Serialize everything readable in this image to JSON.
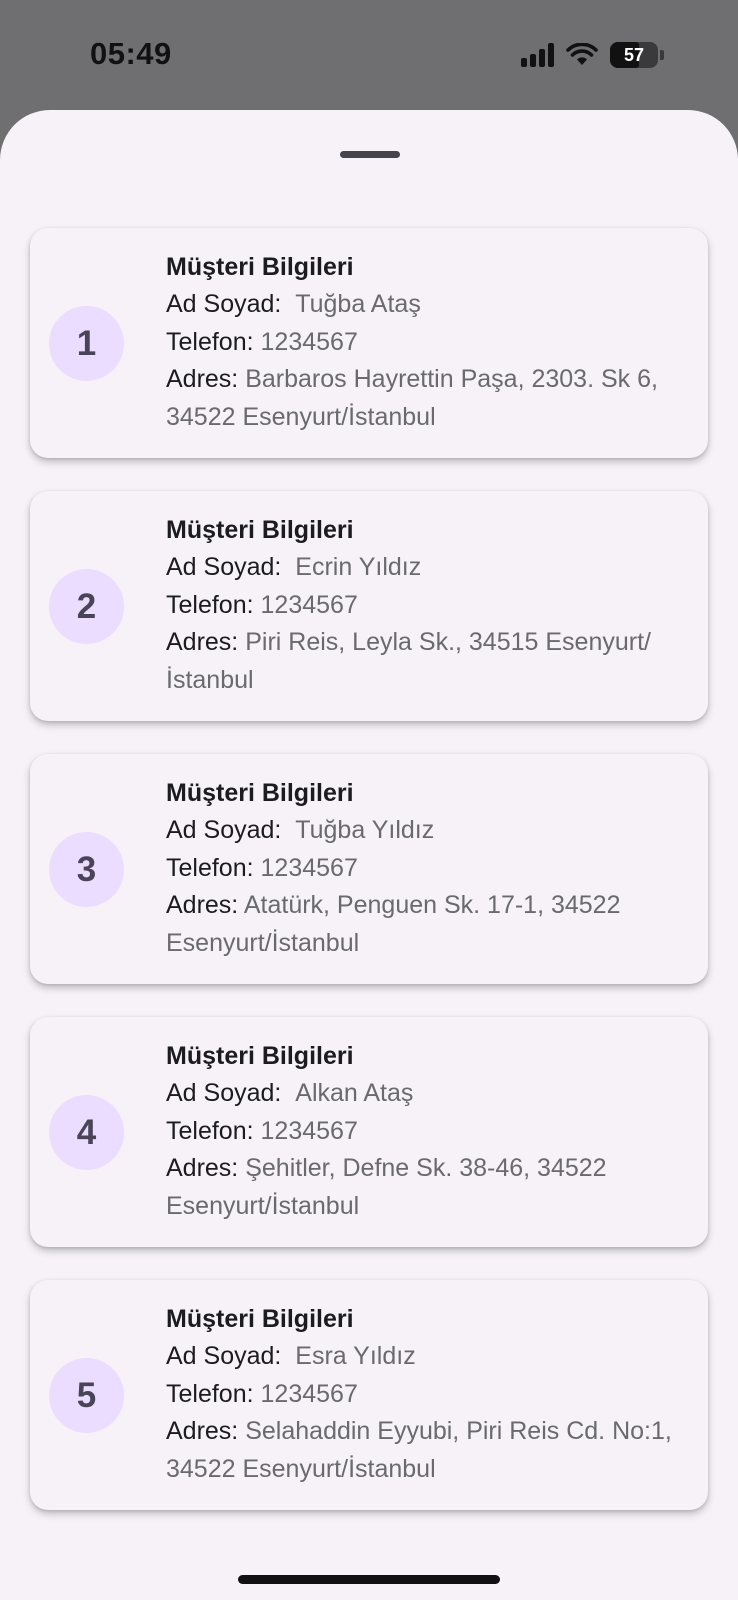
{
  "status_bar": {
    "time": "05:49",
    "battery_level": "57"
  },
  "customers": [
    {
      "number": "1",
      "title": "Müşteri Bilgileri",
      "name_label": "Ad Soyad:",
      "name": "Tuğba Ataş",
      "phone_label": "Telefon:",
      "phone": "1234567",
      "address_label": "Adres:",
      "address": "Barbaros Hayrettin Paşa, 2303. Sk 6, 34522 Esenyurt/İstanbul"
    },
    {
      "number": "2",
      "title": "Müşteri Bilgileri",
      "name_label": "Ad Soyad:",
      "name": "Ecrin Yıldız",
      "phone_label": "Telefon:",
      "phone": "1234567",
      "address_label": "Adres:",
      "address": "Piri Reis, Leyla Sk., 34515 Esenyurt/İstanbul"
    },
    {
      "number": "3",
      "title": "Müşteri Bilgileri",
      "name_label": "Ad Soyad:",
      "name": "Tuğba Yıldız",
      "phone_label": "Telefon:",
      "phone": "1234567",
      "address_label": "Adres:",
      "address": "Atatürk, Penguen Sk. 17-1, 34522 Esenyurt/İstanbul"
    },
    {
      "number": "4",
      "title": "Müşteri Bilgileri",
      "name_label": "Ad Soyad:",
      "name": "Alkan Ataş",
      "phone_label": "Telefon:",
      "phone": "1234567",
      "address_label": "Adres:",
      "address": "Şehitler, Defne Sk. 38-46, 34522 Esenyurt/İstanbul"
    },
    {
      "number": "5",
      "title": "Müşteri Bilgileri",
      "name_label": "Ad Soyad:",
      "name": "Esra Yıldız",
      "phone_label": "Telefon:",
      "phone": "1234567",
      "address_label": "Adres:",
      "address": "Selahaddin Eyyubi, Piri Reis Cd. No:1, 34522 Esenyurt/İstanbul"
    }
  ],
  "icons": {
    "signal": "cellular-signal-icon",
    "wifi": "wifi-icon",
    "battery": "battery-icon"
  }
}
